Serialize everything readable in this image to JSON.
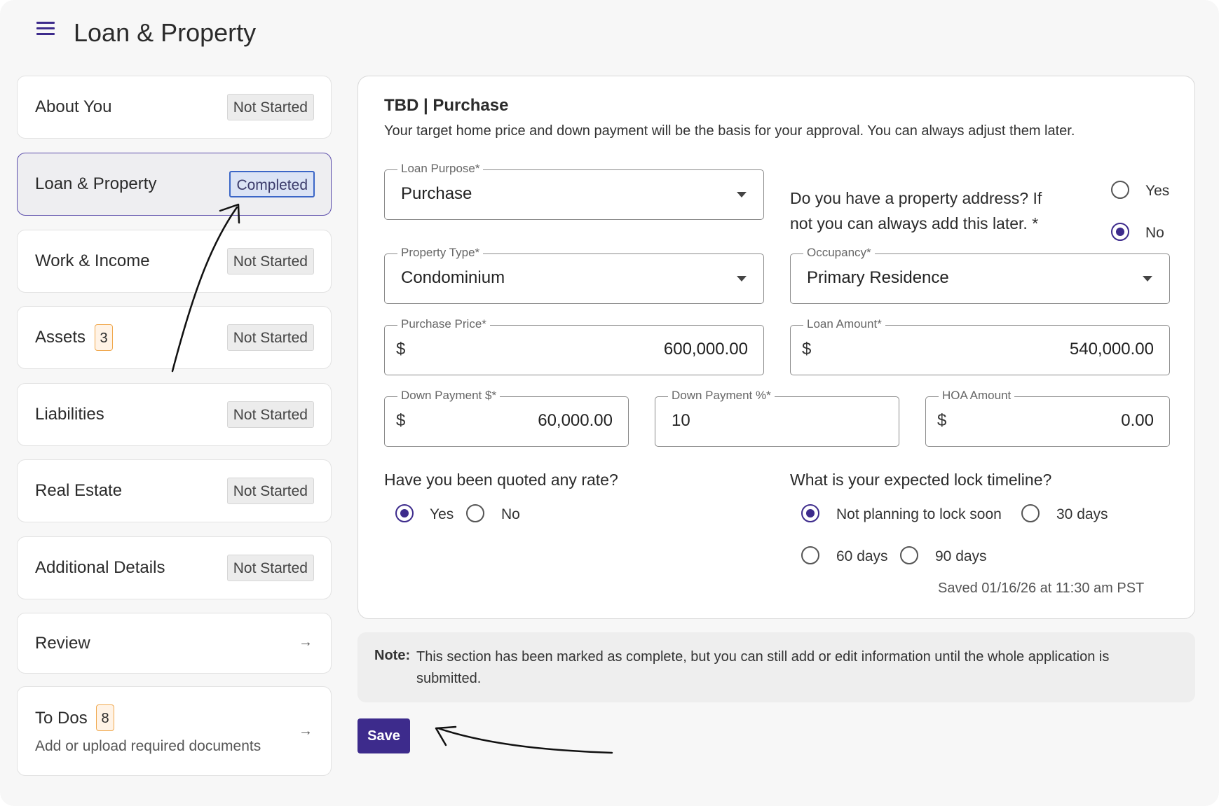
{
  "header": {
    "title": "Loan & Property",
    "menu_icon": "hamburger-menu-icon"
  },
  "sidebar": {
    "items": [
      {
        "label": "About You",
        "status": "Not Started"
      },
      {
        "label": "Loan & Property",
        "status": "Completed"
      },
      {
        "label": "Work & Income",
        "status": "Not Started"
      },
      {
        "label": "Assets",
        "count": "3",
        "status": "Not Started"
      },
      {
        "label": "Liabilities",
        "status": "Not Started"
      },
      {
        "label": "Real Estate",
        "status": "Not Started"
      },
      {
        "label": "Additional Details",
        "status": "Not Started"
      },
      {
        "label": "Review",
        "icon": "arrow-right-icon"
      },
      {
        "label": "To Dos",
        "count": "8",
        "subtitle": "Add or upload required documents",
        "icon": "arrow-right-icon"
      }
    ]
  },
  "form": {
    "title": "TBD | Purchase",
    "description": "Your target home price and down payment will be the basis for your approval. You can always adjust them later.",
    "loan_purpose": {
      "label": "Loan Purpose*",
      "value": "Purchase"
    },
    "property_address_question": {
      "line1": "Do you have a property address? If",
      "line2": "not you can always add this later. *",
      "options": [
        "Yes",
        "No"
      ],
      "selected": "No"
    },
    "property_type": {
      "label": "Property Type*",
      "value": "Condominium"
    },
    "occupancy": {
      "label": "Occupancy*",
      "value": "Primary Residence"
    },
    "purchase_price": {
      "label": "Purchase Price*",
      "currency": "$",
      "value": "600,000.00"
    },
    "loan_amount": {
      "label": "Loan Amount*",
      "currency": "$",
      "value": "540,000.00"
    },
    "down_payment_amount": {
      "label": "Down Payment $*",
      "currency": "$",
      "value": "60,000.00"
    },
    "down_payment_percent": {
      "label": "Down Payment %*",
      "value": "10"
    },
    "hoa_amount": {
      "label": "HOA Amount",
      "currency": "$",
      "value": "0.00"
    },
    "rate_question": {
      "label": "Have you been quoted any rate?",
      "options": [
        "Yes",
        "No"
      ],
      "selected": "Yes"
    },
    "lock_question": {
      "label": "What is your expected lock timeline?",
      "options": [
        "Not planning to lock soon",
        "30 days",
        "60 days",
        "90 days"
      ],
      "selected": "Not planning to lock soon"
    },
    "saved_text": "Saved 01/16/26 at 11:30 am PST"
  },
  "note": {
    "key": "Note:",
    "text": "This section has been marked as complete, but you can still add or edit information until the whole application is submitted."
  },
  "save_button": "Save",
  "colors": {
    "accent": "#3d2b8c",
    "completed_badge_border": "#3b66c7",
    "count_badge": "#f0a84d"
  }
}
